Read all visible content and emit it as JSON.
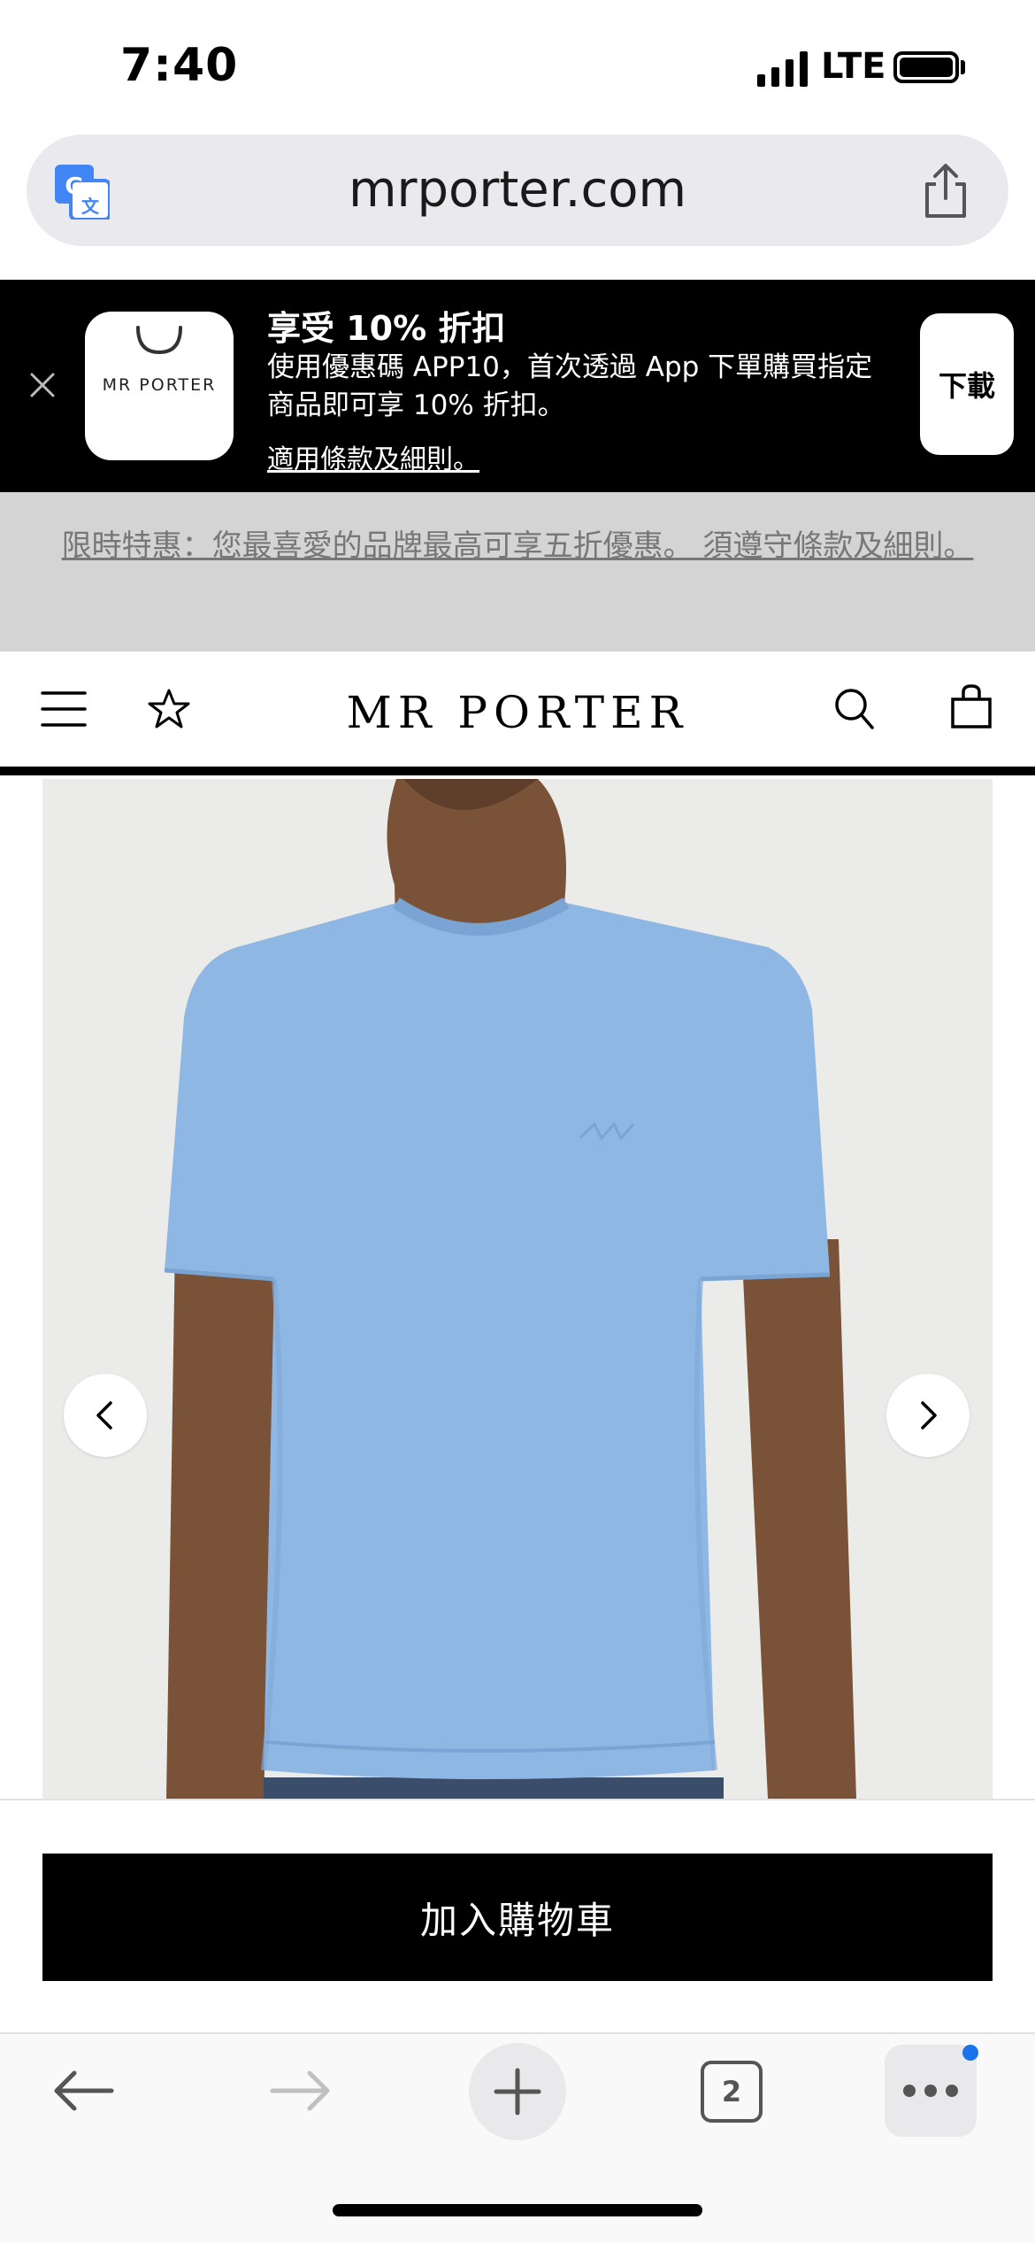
{
  "status_bar": {
    "time": "7:40",
    "network": "LTE"
  },
  "browser": {
    "url": "mrporter.com",
    "tab_count": "2"
  },
  "app_banner": {
    "app_name": "MR PORTER",
    "title": "享受 10% 折扣",
    "body": "使用優惠碼 APP10，首次透過 App 下單購買指定商品即可享 10% 折扣。",
    "terms_link": "適用條款及細則。",
    "download_label": "下載"
  },
  "promo": {
    "text": "限時特惠：您最喜愛的品牌最高可享五折優惠。 須遵守條款及細則。"
  },
  "header": {
    "logo": "MR PORTER"
  },
  "product": {
    "add_to_cart_label": "加入購物車"
  },
  "colors": {
    "shirt": "#8fb7e4",
    "accent": "#1a73e8"
  }
}
